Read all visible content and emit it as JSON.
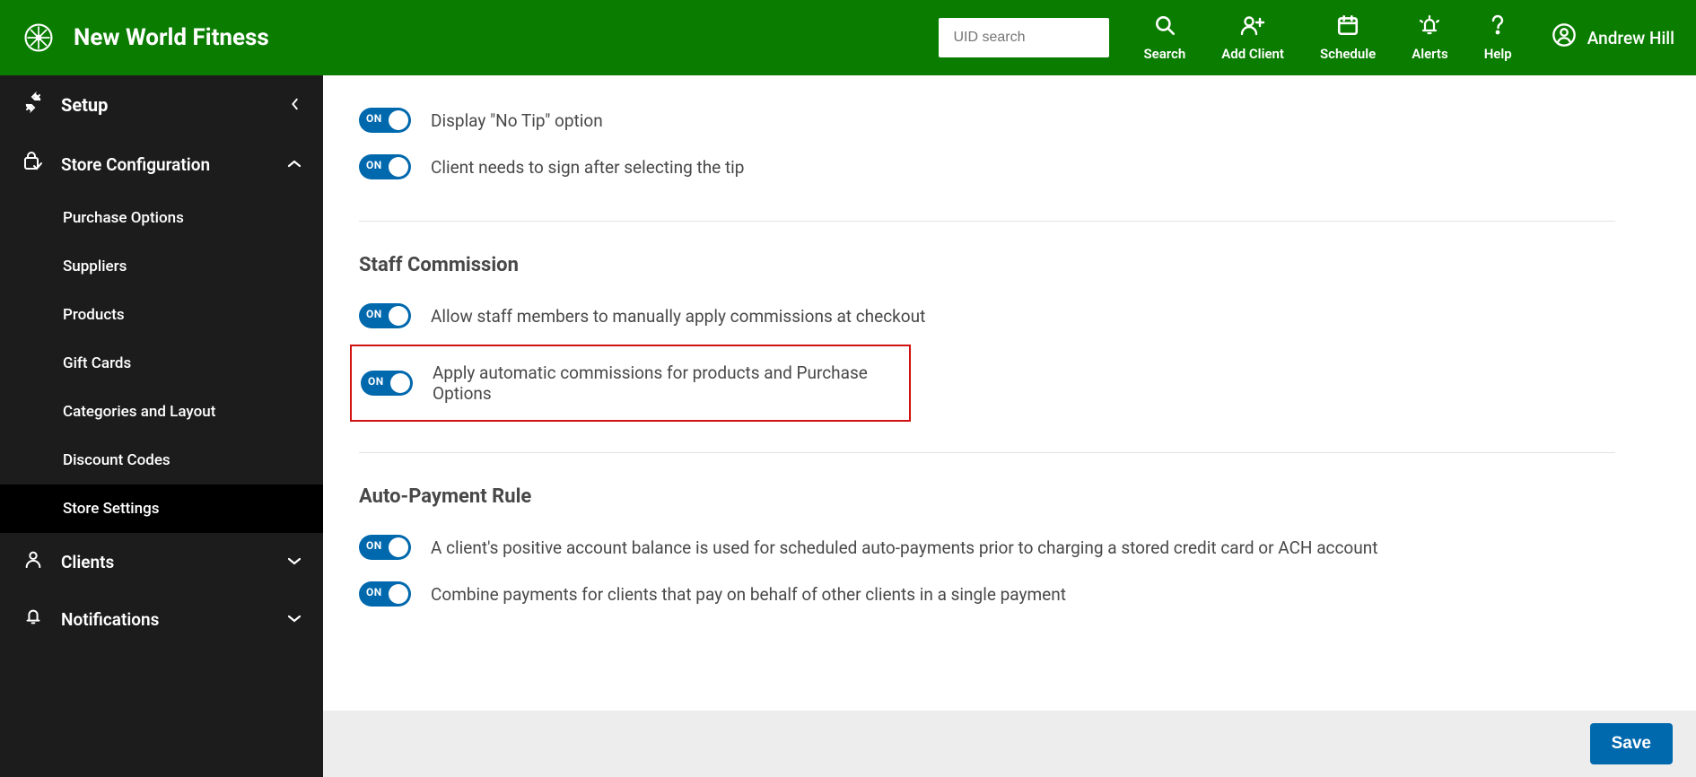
{
  "header": {
    "brand": "New World Fitness",
    "search_placeholder": "UID search",
    "actions": {
      "search": "Search",
      "add_client": "Add Client",
      "schedule": "Schedule",
      "alerts": "Alerts",
      "help": "Help"
    },
    "user_name": "Andrew Hill"
  },
  "sidebar": {
    "setup_label": "Setup",
    "store_config_label": "Store Configuration",
    "clients_label": "Clients",
    "notifications_label": "Notifications",
    "sub_items": [
      "Purchase Options",
      "Suppliers",
      "Products",
      "Gift Cards",
      "Categories and Layout",
      "Discount Codes",
      "Store Settings"
    ]
  },
  "settings": {
    "toggle_on": "ON",
    "display_no_tip": "Display \"No Tip\" option",
    "client_sign": "Client needs to sign after selecting the tip",
    "staff_commission_heading": "Staff Commission",
    "allow_manual_commission": "Allow staff members to manually apply commissions at checkout",
    "auto_commission": "Apply automatic commissions for products and Purchase Options",
    "auto_payment_heading": "Auto-Payment Rule",
    "positive_balance_rule": "A client's positive account balance is used for scheduled auto-payments prior to charging a stored credit card or ACH account",
    "combine_payments": "Combine payments for clients that pay on behalf of other clients in a single payment"
  },
  "footer": {
    "save": "Save"
  }
}
